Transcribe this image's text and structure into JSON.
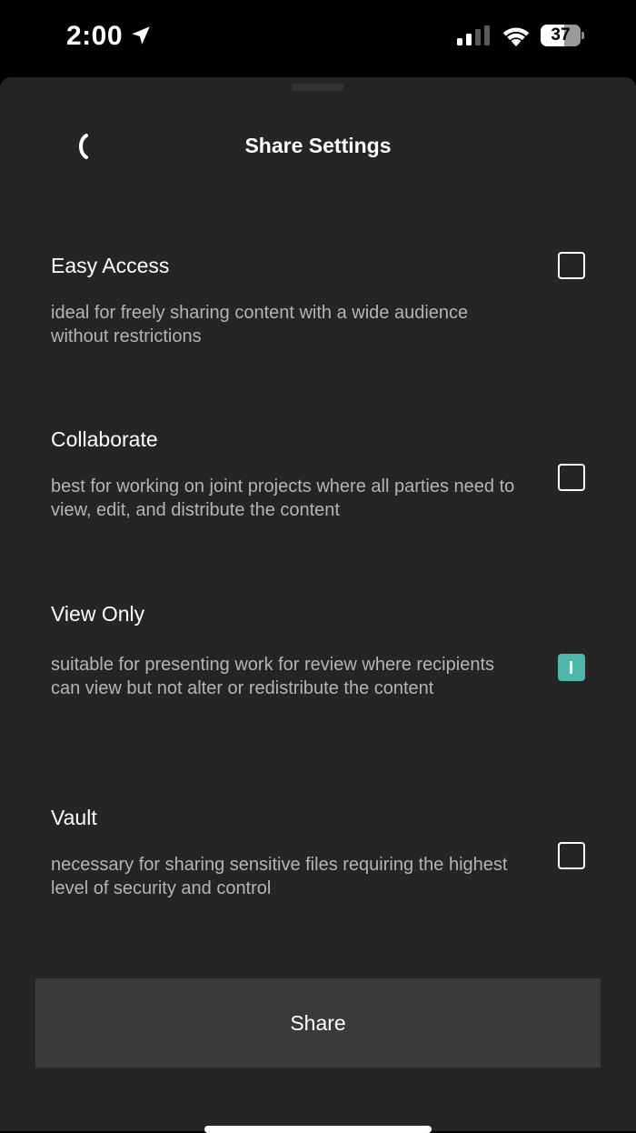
{
  "status_bar": {
    "time": "2:00",
    "battery_level": "37",
    "battery_fraction": 0.37,
    "signal_bars_active": 2,
    "signal_bars_total": 4,
    "icons": [
      "location-arrow-icon",
      "cellular-signal-icon",
      "wifi-icon",
      "battery-icon"
    ]
  },
  "header": {
    "title": "Share Settings",
    "back_icon": "chevron-left-icon"
  },
  "options": [
    {
      "title": "Easy Access",
      "description": "ideal for freely sharing content with a wide audience without restrictions",
      "checked": false
    },
    {
      "title": "Collaborate",
      "description": "best for working on joint projects where all parties need to view, edit, and distribute the content",
      "checked": false
    },
    {
      "title": "View Only",
      "description": "suitable for presenting work for review where recipients can view but not alter or redistribute the content",
      "checked": true
    },
    {
      "title": "Vault",
      "description": "necessary for sharing sensitive files requiring the highest level of security and control",
      "checked": false
    }
  ],
  "share_button": {
    "label": "Share"
  },
  "colors": {
    "background": "#000000",
    "sheet": "#252525",
    "button": "#3a3a3a",
    "accent": "#4db8aa",
    "description_text": "#b4b4b4"
  }
}
